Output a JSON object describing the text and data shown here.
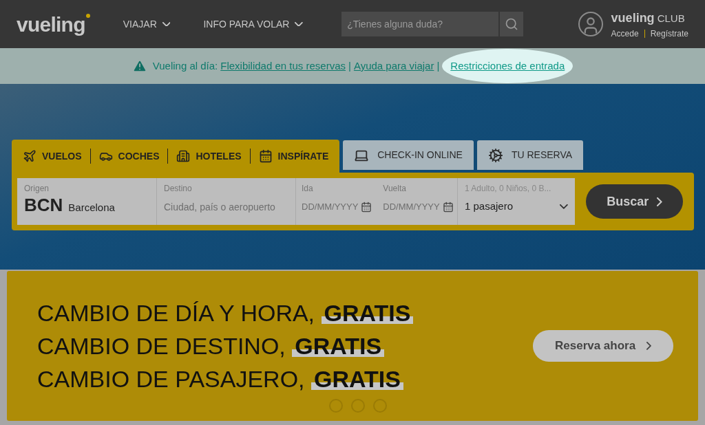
{
  "header": {
    "logo": "vueling",
    "nav": [
      {
        "label": "VIAJAR"
      },
      {
        "label": "INFO PARA VOLAR"
      }
    ],
    "search": {
      "placeholder": "¿Tienes alguna duda?"
    },
    "club": {
      "logo": "vueling",
      "suffix": "CLUB",
      "links": [
        "Accede",
        "Regístrate"
      ]
    }
  },
  "alert": {
    "prefix": "Vueling al día:",
    "links": [
      {
        "label": "Flexibilidad en tus reservas",
        "highlighted": false
      },
      {
        "label": "Ayuda para viajar",
        "highlighted": false
      },
      {
        "label": "Restricciones de entrada",
        "highlighted": true
      }
    ],
    "separator": "|"
  },
  "product_tabs": [
    {
      "label": "VUELOS"
    },
    {
      "label": "COCHES"
    },
    {
      "label": "HOTELES"
    },
    {
      "label": "INSPÍRATE"
    }
  ],
  "service_tabs": [
    {
      "label": "CHECK-IN ONLINE"
    },
    {
      "label": "TU RESERVA"
    }
  ],
  "form": {
    "origin": {
      "label": "Origen",
      "code": "BCN",
      "city": "Barcelona"
    },
    "destination": {
      "label": "Destino",
      "placeholder": "Ciudad, país o aeropuerto"
    },
    "dates": [
      {
        "label": "Ida",
        "placeholder": "DD/MM/YYYY"
      },
      {
        "label": "Vuelta",
        "placeholder": "DD/MM/YYYY"
      }
    ],
    "passengers": {
      "label": "1 Adulto, 0 Niños, 0 B...",
      "value": "1 pasajero"
    },
    "submit": "Buscar"
  },
  "promo": {
    "lines": [
      {
        "text": "CAMBIO DE DÍA Y HORA,",
        "highlight": "GRATIS"
      },
      {
        "text": "CAMBIO DE DESTINO,",
        "highlight": "GRATIS"
      },
      {
        "text": "CAMBIO DE PASAJERO,",
        "highlight": "GRATIS"
      }
    ],
    "button": "Reserva ahora"
  }
}
